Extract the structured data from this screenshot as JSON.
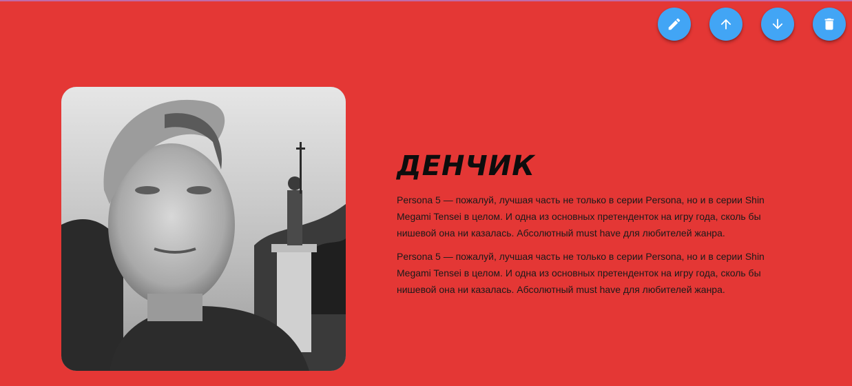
{
  "profile": {
    "name": "ДЕНЧИК",
    "paragraphs": [
      "Persona 5 — пожалуй, лучшая часть не только в серии Persona, но и в серии Shin Megami Tensei в целом. И одна из основных претенденток на игру года, сколь бы нишевой она ни казалась. Абсолютный must have для любителей жанра.",
      "Persona 5 — пожалуй, лучшая часть не только в серии Persona, но и в серии Shin Megami Tensei в целом. И одна из основных претенденток на игру года, сколь бы нишевой она ни казалась. Абсолютный must have для любителей жанра."
    ]
  },
  "toolbar": {
    "buttons": [
      {
        "icon": "pencil-icon"
      },
      {
        "icon": "arrow-up-icon"
      },
      {
        "icon": "arrow-down-icon"
      },
      {
        "icon": "trash-icon"
      }
    ]
  },
  "colors": {
    "background": "#e43735",
    "fab": "#42a5f5",
    "text": "#1a1a1a"
  }
}
